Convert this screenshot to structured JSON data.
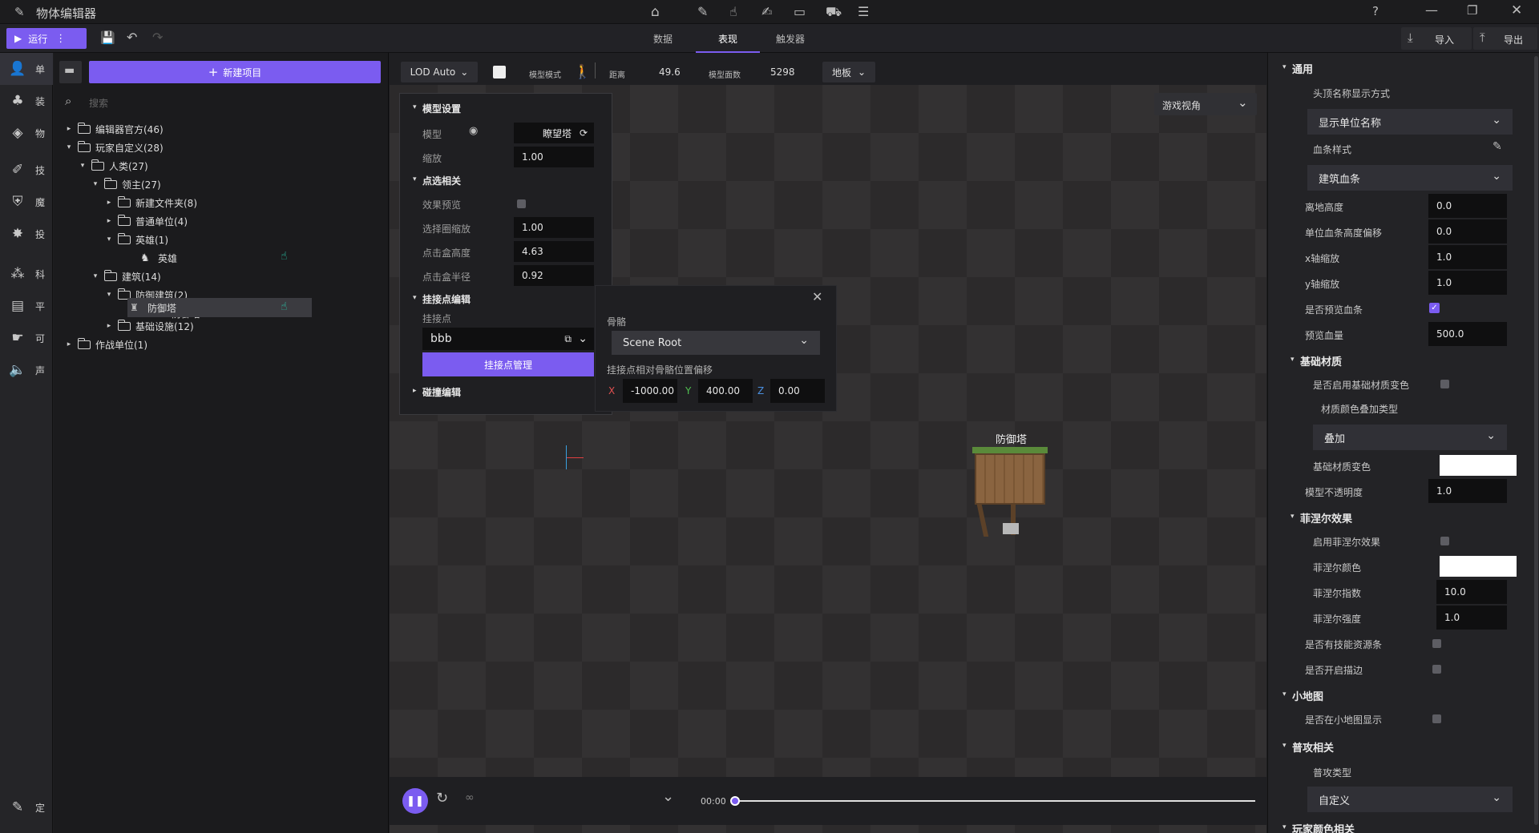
{
  "app": {
    "title": "物体编辑器"
  },
  "toolbar": {
    "run_label": "运行",
    "tabs": [
      "数据",
      "表现",
      "触发器"
    ],
    "active_tab": "表现",
    "import_label": "导入",
    "export_label": "导出"
  },
  "rail": [
    "单",
    "装",
    "物",
    "技",
    "魔",
    "投",
    "科",
    "平",
    "可",
    "声",
    "定"
  ],
  "tree": {
    "new_project_label": "新建项目",
    "search_placeholder": "搜索",
    "rows": [
      {
        "label": "编辑器官方(46)",
        "arrow": "▸"
      },
      {
        "label": "玩家自定义(28)",
        "arrow": "▾"
      },
      {
        "label": "人类(27)",
        "arrow": "▾"
      },
      {
        "label": "领主(27)",
        "arrow": "▾"
      },
      {
        "label": "新建文件夹(8)",
        "arrow": "▸"
      },
      {
        "label": "普通单位(4)",
        "arrow": "▸"
      },
      {
        "label": "英雄(1)",
        "arrow": "▾"
      },
      {
        "label": "英雄",
        "arrow": ""
      },
      {
        "label": "建筑(14)",
        "arrow": "▾"
      },
      {
        "label": "防御建筑(2)",
        "arrow": "▾"
      },
      {
        "label": "防御塔",
        "arrow": ""
      },
      {
        "label": "防御塔",
        "arrow": ""
      },
      {
        "label": "基础设施(12)",
        "arrow": "▸"
      },
      {
        "label": "作战单位(1)",
        "arrow": "▸"
      }
    ]
  },
  "viewport": {
    "lod": "LOD Auto",
    "model_mode_label": "模型模式",
    "distance_label": "距离",
    "distance_value": "49.6",
    "faces_label": "模型面数",
    "faces_value": "5298",
    "floor_label": "地板",
    "view_mode": "游戏视角",
    "object_label": "防御塔"
  },
  "model_panel": {
    "model_settings": "模型设置",
    "model_label": "模型",
    "model_value": "瞭望塔",
    "scale_label": "缩放",
    "scale_value": "1.00",
    "pick_section": "点选相关",
    "effect_preview": "效果预览",
    "circle_scale_label": "选择圈缩放",
    "circle_scale_value": "1.00",
    "box_height_label": "点击盒高度",
    "box_height_value": "4.63",
    "box_radius_label": "点击盒半径",
    "box_radius_value": "0.92",
    "attach_section": "挂接点编辑",
    "attach_label": "挂接点",
    "attach_value": "bbb",
    "attach_manage": "挂接点管理",
    "collision_section": "碰撞编辑"
  },
  "bone_panel": {
    "bone_label": "骨骼",
    "bone_value": "Scene Root",
    "offset_label": "挂接点相对骨骼位置偏移",
    "x": "-1000.00",
    "y": "400.00",
    "z": "0.00"
  },
  "timeline": {
    "time": "00:00"
  },
  "props": {
    "general": "通用",
    "name_display_label": "头顶名称显示方式",
    "name_display_value": "显示单位名称",
    "hp_style_label": "血条样式",
    "hp_style_value": "建筑血条",
    "ground_height_label": "离地高度",
    "ground_height_value": "0.0",
    "hp_offset_label": "单位血条高度偏移",
    "hp_offset_value": "0.0",
    "x_scale_label": "x轴缩放",
    "x_scale_value": "1.0",
    "y_scale_label": "y轴缩放",
    "y_scale_value": "1.0",
    "preview_hp_label": "是否预览血条",
    "preview_hp_amount_label": "预览血量",
    "preview_hp_amount_value": "500.0",
    "base_material": "基础材质",
    "enable_base_color_label": "是否启用基础材质变色",
    "color_overlay_label": "材质颜色叠加类型",
    "color_overlay_value": "叠加",
    "base_color_label": "基础材质变色",
    "opacity_label": "模型不透明度",
    "opacity_value": "1.0",
    "fresnel": "菲涅尔效果",
    "enable_fresnel_label": "启用菲涅尔效果",
    "fresnel_color_label": "菲涅尔颜色",
    "fresnel_index_label": "菲涅尔指数",
    "fresnel_index_value": "10.0",
    "fresnel_strength_label": "菲涅尔强度",
    "fresnel_strength_value": "1.0",
    "skill_res_label": "是否有技能资源条",
    "outline_label": "是否开启描边",
    "minimap": "小地图",
    "minimap_show_label": "是否在小地图显示",
    "attack": "普攻相关",
    "attack_type_label": "普攻类型",
    "attack_type_value": "自定义",
    "player_color": "玩家颜色相关"
  },
  "colors": {
    "accent": "#7b5cf0",
    "hand": "#28c7a8"
  }
}
